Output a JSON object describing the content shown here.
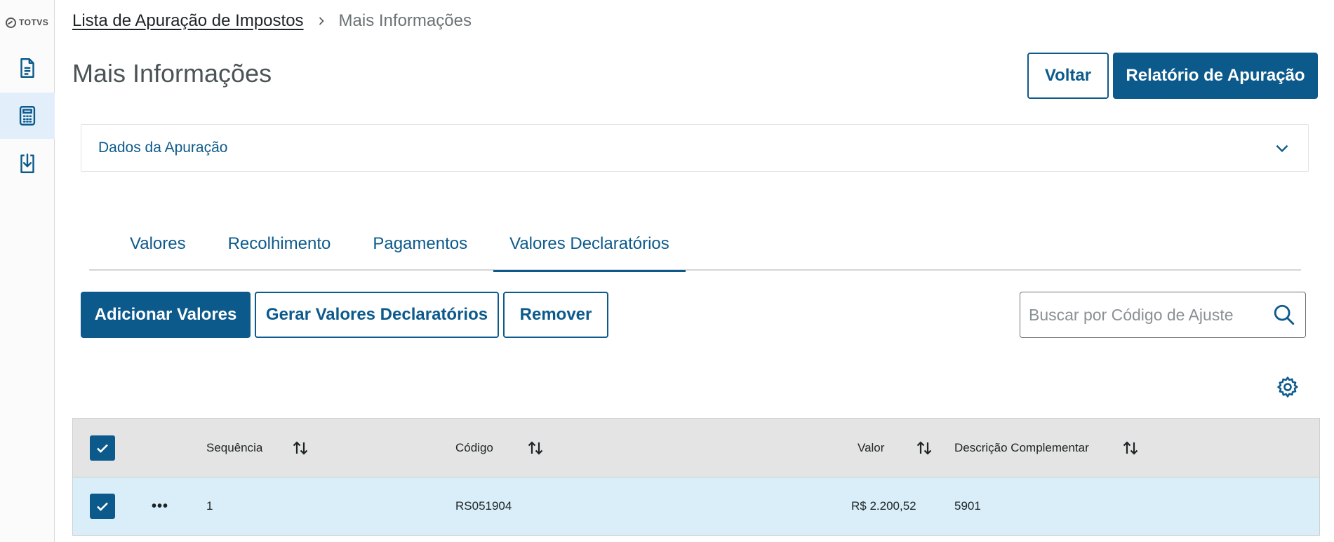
{
  "logo": {
    "text": "TOTVS"
  },
  "sidebar": {
    "items": [
      {
        "icon": "document-icon",
        "active": false
      },
      {
        "icon": "calculator-icon",
        "active": true
      },
      {
        "icon": "download-document-icon",
        "active": false
      }
    ]
  },
  "breadcrumb": {
    "link": "Lista de Apuração de Impostos",
    "current": "Mais Informações"
  },
  "page": {
    "title": "Mais Informações"
  },
  "header_buttons": {
    "back": "Voltar",
    "report": "Relatório de Apuração"
  },
  "accordion": {
    "title": "Dados da Apuração"
  },
  "tabs": [
    {
      "label": "Valores",
      "active": false
    },
    {
      "label": "Recolhimento",
      "active": false
    },
    {
      "label": "Pagamentos",
      "active": false
    },
    {
      "label": "Valores Declaratórios",
      "active": true
    }
  ],
  "actions": {
    "add": "Adicionar Valores",
    "generate": "Gerar Valores Declaratórios",
    "remove": "Remover"
  },
  "search": {
    "placeholder": "Buscar por Código de Ajuste",
    "value": ""
  },
  "table": {
    "columns": [
      "Sequência",
      "Código",
      "Valor",
      "Descrição Complementar"
    ],
    "rows": [
      {
        "selected": true,
        "sequencia": "1",
        "codigo": "RS051904",
        "valor": "R$ 2.200,52",
        "descricao": "5901"
      }
    ],
    "all_selected": true
  },
  "colors": {
    "primary": "#0c5a8c",
    "row_selected": "#d9eef9",
    "header_bg": "#e4e4e4",
    "sidebar_active": "#e2effa"
  }
}
